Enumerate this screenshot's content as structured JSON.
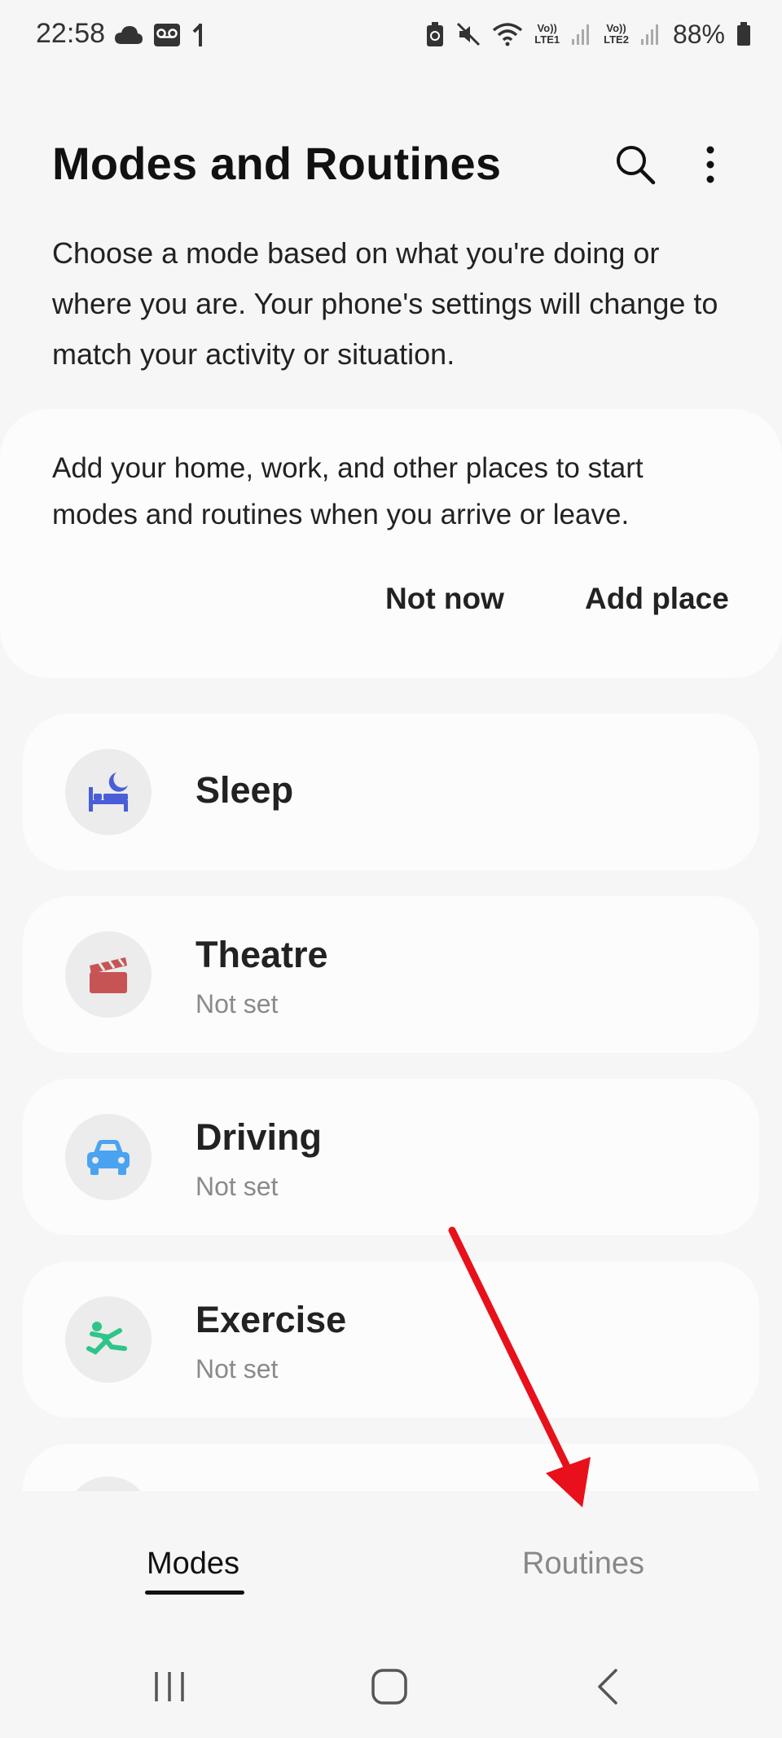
{
  "status_bar": {
    "time": "22:58",
    "battery": "88%",
    "sim1_label": "LTE1",
    "sim2_label": "LTE2",
    "volte_label": "Vo))",
    "icons": [
      "cloud-icon",
      "voicemail-icon",
      "download-icon",
      "battery-saver-icon",
      "mute-icon",
      "wifi-icon",
      "signal-icon",
      "battery-icon"
    ]
  },
  "header": {
    "title": "Modes and Routines",
    "search_icon": "search-icon",
    "more_icon": "more-vertical-icon"
  },
  "description": "Choose a mode based on what you're doing or where you are. Your phone's settings will change to match your activity or situation.",
  "place_card": {
    "text": "Add your home, work, and other places to start modes and routines when you arrive or leave.",
    "not_now": "Not now",
    "add_place": "Add place"
  },
  "modes": [
    {
      "name": "Sleep",
      "status": "",
      "icon": "bed-moon-icon",
      "color": "#4a5ed8"
    },
    {
      "name": "Theatre",
      "status": "Not set",
      "icon": "clapperboard-icon",
      "color": "#c65454"
    },
    {
      "name": "Driving",
      "status": "Not set",
      "icon": "car-icon",
      "color": "#4aa3f0"
    },
    {
      "name": "Exercise",
      "status": "Not set",
      "icon": "running-icon",
      "color": "#2fc58a"
    }
  ],
  "bottom_nav": {
    "modes": "Modes",
    "routines": "Routines",
    "active": "Modes"
  },
  "annotation_color": "#e8101a"
}
